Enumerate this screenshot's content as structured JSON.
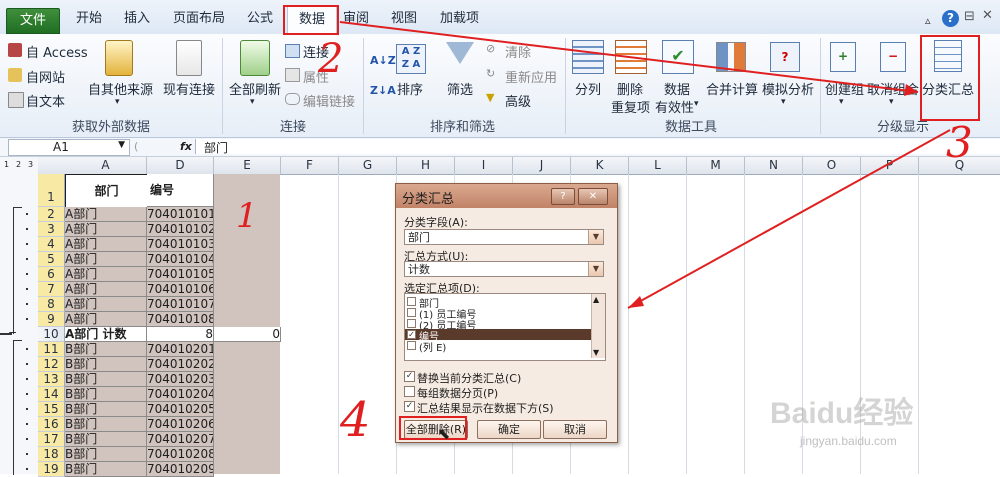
{
  "tabs": {
    "file": "文件",
    "home": "开始",
    "insert": "插入",
    "page_layout": "页面布局",
    "formulas": "公式",
    "data": "数据",
    "review": "审阅",
    "view": "视图",
    "addins": "加载项"
  },
  "ribbon": {
    "ext_data": {
      "from_access": "自 Access",
      "from_web": "自网站",
      "from_text": "自文本",
      "from_other": "自其他来源",
      "existing": "现有连接",
      "label": "获取外部数据"
    },
    "connections": {
      "refresh_all": "全部刷新",
      "connections": "连接",
      "properties": "属性",
      "edit_links": "编辑链接",
      "label": "连接"
    },
    "sort_filter": {
      "sort": "排序",
      "filter": "筛选",
      "clear": "清除",
      "reapply": "重新应用",
      "advanced": "高级",
      "label": "排序和筛选"
    },
    "data_tools": {
      "text_to_columns": "分列",
      "remove_dup_1": "删除",
      "remove_dup_2": "重复项",
      "validation_1": "数据",
      "validation_2": "有效性",
      "consolidate": "合并计算",
      "what_if": "模拟分析",
      "label": "数据工具"
    },
    "outline": {
      "group": "创建组",
      "ungroup": "取消组合",
      "subtotal": "分类汇总",
      "label": "分级显示"
    }
  },
  "formula_bar": {
    "name_box": "A1",
    "fx": "fx",
    "content": "部门"
  },
  "columns": [
    "A",
    "D",
    "E",
    "F",
    "G",
    "H",
    "I",
    "J",
    "K",
    "L",
    "M",
    "N",
    "O",
    "P",
    "Q"
  ],
  "outline_levels": [
    "1",
    "2",
    "3"
  ],
  "header_row": {
    "row": "1",
    "dept": "部门",
    "code": "编号"
  },
  "rows": [
    {
      "n": "2",
      "a": "A部门",
      "d": "704010101"
    },
    {
      "n": "3",
      "a": "A部门",
      "d": "704010102"
    },
    {
      "n": "4",
      "a": "A部门",
      "d": "704010103"
    },
    {
      "n": "5",
      "a": "A部门",
      "d": "704010104"
    },
    {
      "n": "6",
      "a": "A部门",
      "d": "704010105"
    },
    {
      "n": "7",
      "a": "A部门",
      "d": "704010106"
    },
    {
      "n": "8",
      "a": "A部门",
      "d": "704010107"
    },
    {
      "n": "9",
      "a": "A部门",
      "d": "704010108"
    },
    {
      "n": "10",
      "a": "A部门 计数",
      "d": "8",
      "e": "0"
    },
    {
      "n": "11",
      "a": "B部门",
      "d": "704010201"
    },
    {
      "n": "12",
      "a": "B部门",
      "d": "704010202"
    },
    {
      "n": "13",
      "a": "B部门",
      "d": "704010203"
    },
    {
      "n": "14",
      "a": "B部门",
      "d": "704010204"
    },
    {
      "n": "15",
      "a": "B部门",
      "d": "704010205"
    },
    {
      "n": "16",
      "a": "B部门",
      "d": "704010206"
    },
    {
      "n": "17",
      "a": "B部门",
      "d": "704010207"
    },
    {
      "n": "18",
      "a": "B部门",
      "d": "704010208"
    },
    {
      "n": "19",
      "a": "B部门",
      "d": "704010209"
    }
  ],
  "dialog": {
    "title": "分类汇总",
    "help": "?",
    "close": "✕",
    "field_label": "分类字段(A):",
    "field_value": "部门",
    "func_label": "汇总方式(U):",
    "func_value": "计数",
    "items_label": "选定汇总项(D):",
    "items": [
      {
        "label": "部门",
        "checked": false
      },
      {
        "label": "(1) 员工编号",
        "checked": false
      },
      {
        "label": "(2) 员工编号",
        "checked": false
      },
      {
        "label": "编号",
        "checked": true
      },
      {
        "label": "(列 E)",
        "checked": false
      }
    ],
    "opt_replace": "替换当前分类汇总(C)",
    "opt_pagebreak": "每组数据分页(P)",
    "opt_summary_below": "汇总结果显示在数据下方(S)",
    "btn_remove_all": "全部删除(R)",
    "btn_ok": "确定",
    "btn_cancel": "取消"
  },
  "annotations": {
    "n1": "1",
    "n2": "2",
    "n3": "3",
    "n4": "4"
  },
  "watermark": {
    "brand": "Baidu经验",
    "url": "jingyan.baidu.com"
  },
  "colors": {
    "accent_red": "#e02020",
    "file_tab": "#2c7d30",
    "dialog_title": "#c28367"
  }
}
